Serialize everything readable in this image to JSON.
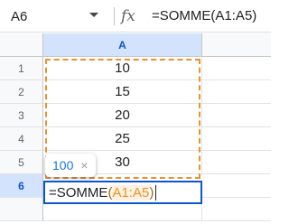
{
  "formula_bar": {
    "name_box": "A6",
    "fx_label": "fx",
    "formula": "=SOMME(A1:A5)"
  },
  "grid": {
    "column_header": "A",
    "rows": [
      {
        "label": "1",
        "value": "10"
      },
      {
        "label": "2",
        "value": "15"
      },
      {
        "label": "3",
        "value": "20"
      },
      {
        "label": "4",
        "value": "25"
      },
      {
        "label": "5",
        "value": "30"
      },
      {
        "label": "6",
        "value": ""
      }
    ],
    "active_row": "6"
  },
  "editor": {
    "fn": "=SOMME",
    "open_paren": "(",
    "range": "A1:A5",
    "close_paren": ")"
  },
  "tooltip": {
    "value": "100",
    "close": "×"
  },
  "colors": {
    "accent_blue": "#0b57d0",
    "range_orange": "#e8912d",
    "header_selected": "#d3e3fd"
  },
  "icons": {
    "name_box_dropdown": "caret-down-icon",
    "formula": "fx-icon",
    "tooltip_close": "close-icon"
  }
}
